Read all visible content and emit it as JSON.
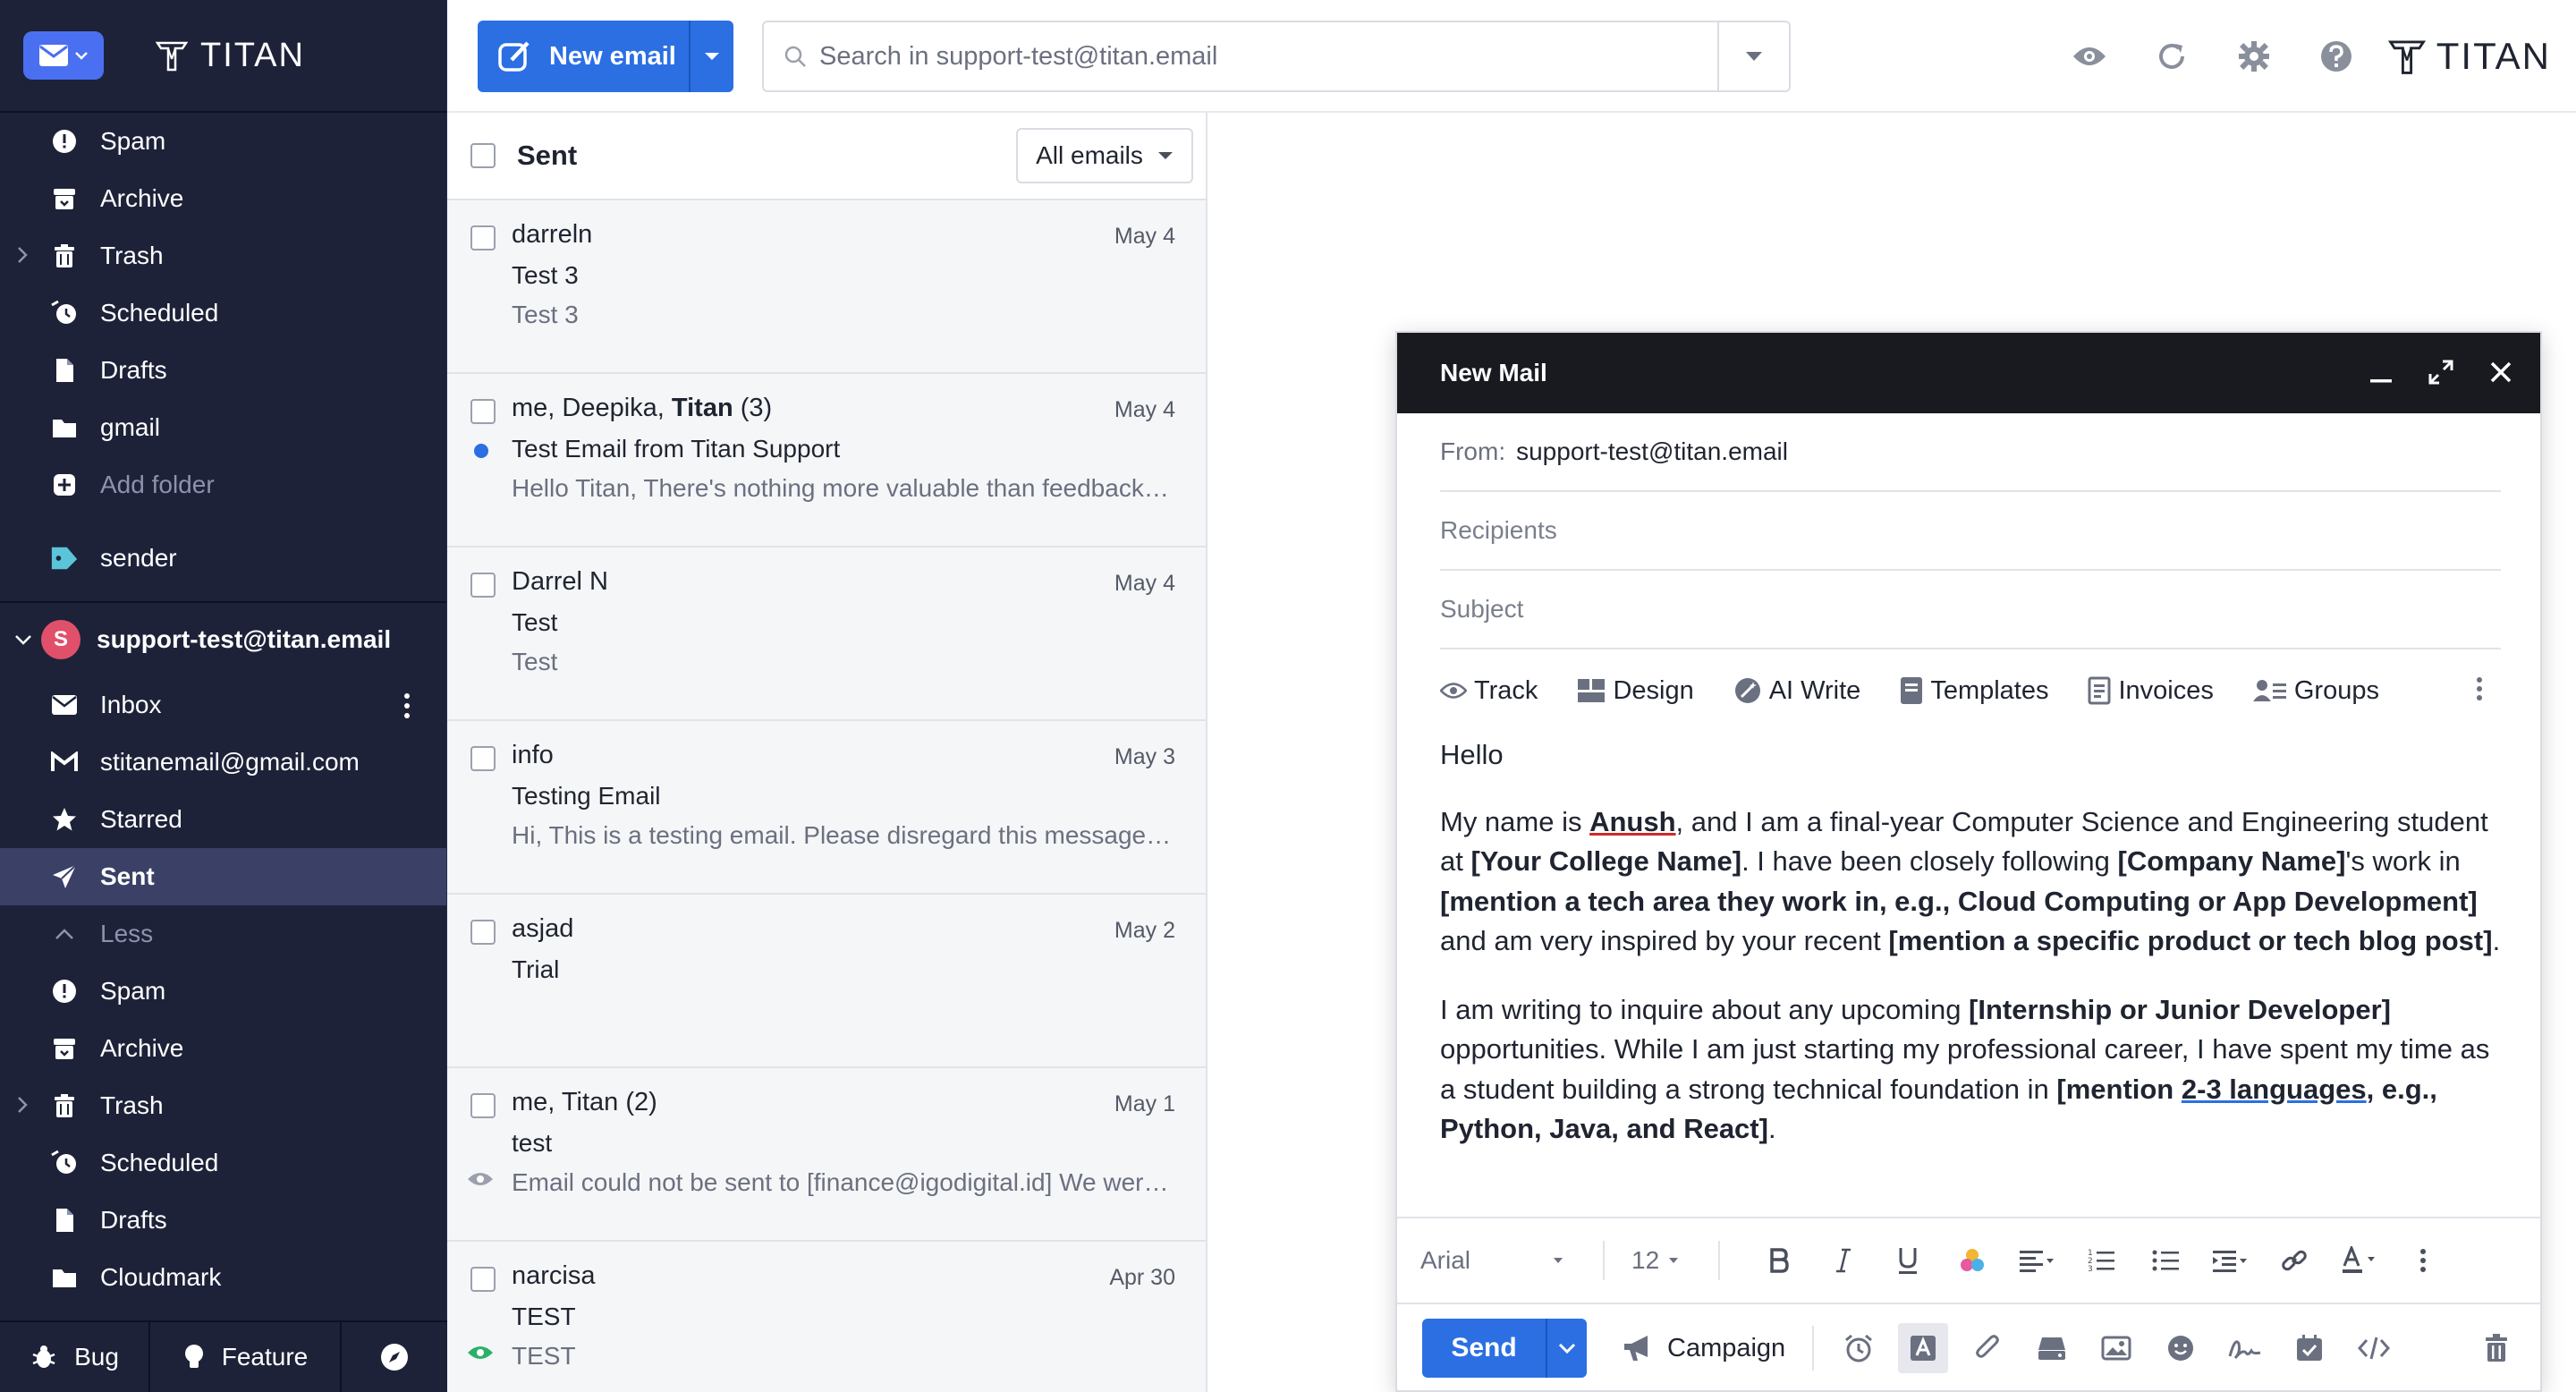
{
  "brand": {
    "name": "TITAN"
  },
  "sidebar": {
    "folders_top": [
      {
        "label": "Spam",
        "icon": "spam-icon"
      },
      {
        "label": "Archive",
        "icon": "archive-icon"
      },
      {
        "label": "Trash",
        "icon": "trash-icon"
      },
      {
        "label": "Scheduled",
        "icon": "scheduled-icon"
      },
      {
        "label": "Drafts",
        "icon": "drafts-icon"
      },
      {
        "label": "gmail",
        "icon": "folder-icon"
      },
      {
        "label": "Add folder",
        "icon": "add-folder-icon"
      }
    ],
    "label_item": "sender",
    "account": {
      "initial": "S",
      "email": "support-test@titan.email"
    },
    "folders_account": [
      {
        "label": "Inbox",
        "icon": "inbox-icon"
      },
      {
        "label": "stitanemail@gmail.com",
        "icon": "gmail-icon"
      },
      {
        "label": "Starred",
        "icon": "star-icon"
      },
      {
        "label": "Sent",
        "icon": "sent-icon"
      },
      {
        "label": "Less",
        "icon": "chevron-up-icon"
      },
      {
        "label": "Spam",
        "icon": "spam-icon"
      },
      {
        "label": "Archive",
        "icon": "archive-icon"
      },
      {
        "label": "Trash",
        "icon": "trash-icon"
      },
      {
        "label": "Scheduled",
        "icon": "scheduled-icon"
      },
      {
        "label": "Drafts",
        "icon": "drafts-icon"
      },
      {
        "label": "Cloudmark",
        "icon": "folder-icon"
      }
    ],
    "bottom": {
      "bug": "Bug",
      "feature": "Feature"
    }
  },
  "toolbar": {
    "new_email": "New email",
    "search_placeholder": "Search in support-test@titan.email"
  },
  "list": {
    "title": "Sent",
    "filter": "All emails",
    "items": [
      {
        "from": "darreln",
        "from_bold": "",
        "from_suffix": "",
        "date": "May 4",
        "subject": "Test 3",
        "preview": "Test 3"
      },
      {
        "from": "me, Deepika, ",
        "from_bold": "Titan",
        "from_suffix": " (3)",
        "date": "May 4",
        "subject": "Test Email from Titan Support",
        "preview": "Hello Titan, There's nothing more valuable than feedback from our users like you. We'd love to hear your thoughts"
      },
      {
        "from": "Darrel N",
        "from_bold": "",
        "from_suffix": "",
        "date": "May 4",
        "subject": "Test",
        "preview": "Test"
      },
      {
        "from": "info",
        "from_bold": "",
        "from_suffix": "",
        "date": "May 3",
        "subject": "Testing Email",
        "preview": "Hi, This is a testing email. Please disregard this message and delete it"
      },
      {
        "from": "asjad",
        "from_bold": "",
        "from_suffix": "",
        "date": "May 2",
        "subject": "Trial",
        "preview": ""
      },
      {
        "from": "me, Titan (2)",
        "from_bold": "",
        "from_suffix": "",
        "date": "May 1",
        "subject": "test",
        "preview": "Email could not be sent to [finance@igodigital.id] We were unable to deliver"
      },
      {
        "from": "narcisa",
        "from_bold": "",
        "from_suffix": "",
        "date": "Apr 30",
        "subject": "TEST",
        "preview": "TEST"
      }
    ]
  },
  "compose": {
    "title": "New Mail",
    "from_label": "From:",
    "from_value": "support-test@titan.email",
    "recipients_placeholder": "Recipients",
    "subject_placeholder": "Subject",
    "tools": [
      "Track",
      "Design",
      "AI Write",
      "Templates",
      "Invoices",
      "Groups"
    ],
    "body": {
      "greeting": "Hello",
      "p1": {
        "t1": "My name is ",
        "b1": "Anush",
        "t2": ", and I am a final-year Computer Science and Engineering student at ",
        "b2": "[Your College Name]",
        "t3": ". I have been closely following ",
        "b3": "[Company Name]",
        "t4": "'s work in ",
        "b4": "[mention a tech area they work in, e.g., Cloud Computing or App Development]",
        "t5": " and am very inspired by your recent ",
        "b5": "[mention a specific product or tech blog post]",
        "t6": "."
      },
      "p2": {
        "t1": "I am writing to inquire about any upcoming ",
        "b1": "[Internship or Junior Developer]",
        "t2": " opportunities. While I am just starting my professional career, I have spent my time as a student building a strong technical foundation in ",
        "b2a": "[mention ",
        "b2u": "2-3 languages",
        "b2b": ", e.g., Python, Java, and React]",
        "t3": "."
      }
    },
    "format": {
      "font": "Arial",
      "size": "12"
    },
    "send": "Send",
    "campaign": "Campaign"
  },
  "colors": {
    "sidebar": "#1d2239",
    "accent": "#2b6fe3",
    "compose_header": "#181a1f",
    "active_item": "#3a4066"
  }
}
